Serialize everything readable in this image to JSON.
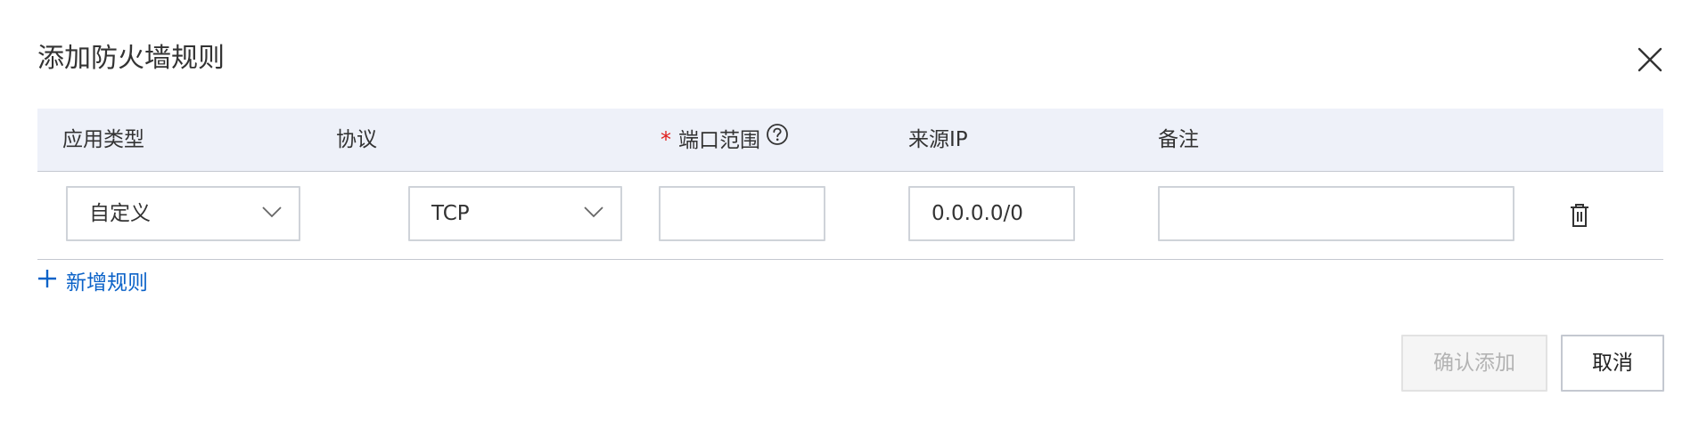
{
  "dialog": {
    "title": "添加防火墙规则",
    "close_icon": "close-icon"
  },
  "table": {
    "headers": {
      "app_type": "应用类型",
      "protocol": "协议",
      "port_required_mark": "*",
      "port_range": "端口范围",
      "source_ip": "来源IP",
      "remark": "备注"
    },
    "help_icon": "question-circle-icon",
    "rows": [
      {
        "app_type": "自定义",
        "protocol": "TCP",
        "port_range": "",
        "source_ip": "0.0.0.0/0",
        "remark": "",
        "delete_icon": "trash-icon"
      }
    ]
  },
  "actions": {
    "add_rule": "新增规则",
    "add_icon": "plus-icon",
    "confirm": "确认添加",
    "cancel": "取消"
  },
  "colors": {
    "header_bg": "#eef1f9",
    "link": "#0b62c8",
    "required": "#e0201e",
    "disabled_text": "#b3b3b3",
    "border": "#cfd3d9"
  }
}
